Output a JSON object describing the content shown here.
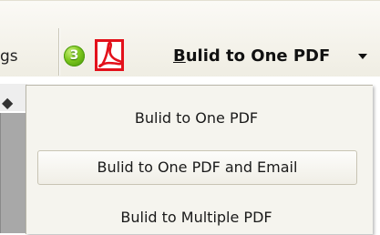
{
  "toolbar": {
    "left_button_label": "gs",
    "step_badge": "3",
    "pdf_icon": "adobe-pdf-icon",
    "build_button": {
      "label_first_char": "B",
      "label_rest": "ulid to One PDF",
      "dropdown_icon": "caret-down"
    }
  },
  "menu": {
    "items": [
      {
        "label": "Bulid to One PDF"
      },
      {
        "label": "Bulid to One PDF and Email",
        "hovered": true
      },
      {
        "label": "Bulid to Multiple PDF"
      }
    ]
  },
  "colors": {
    "toolbar_bg": "#f4f2ea",
    "menu_bg": "#f5f4ee",
    "badge_green": "#7cc61c",
    "pdf_red": "#e3111b"
  }
}
